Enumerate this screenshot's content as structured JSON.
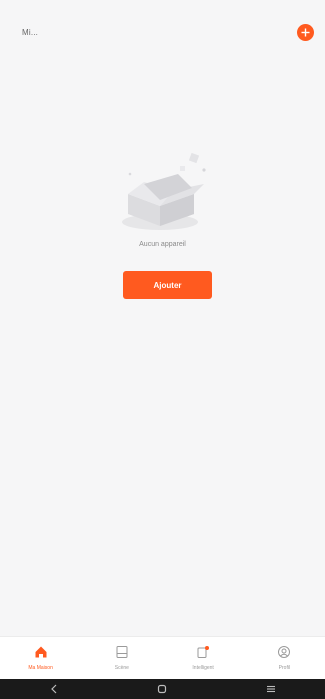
{
  "header": {
    "home_name": "Mi...",
    "add_icon": "plus-icon"
  },
  "empty_state": {
    "illustration_icon": "empty-box-icon",
    "message": "Aucun appareil",
    "button_label": "Ajouter"
  },
  "tabbar": {
    "tabs": [
      {
        "label": "Ma Maison",
        "icon": "home-icon",
        "active": true
      },
      {
        "label": "Scène",
        "icon": "scene-icon",
        "active": false
      },
      {
        "label": "Intelligent",
        "icon": "smart-icon",
        "active": false
      },
      {
        "label": "Profil",
        "icon": "profile-icon",
        "active": false
      }
    ]
  },
  "system_nav": {
    "back_icon": "back-icon",
    "home_icon": "home-circle-icon",
    "menu_icon": "menu-icon"
  },
  "colors": {
    "accent": "#ff5a1f",
    "background": "#f6f6f7",
    "nav_bar": "#1a1a1a"
  }
}
